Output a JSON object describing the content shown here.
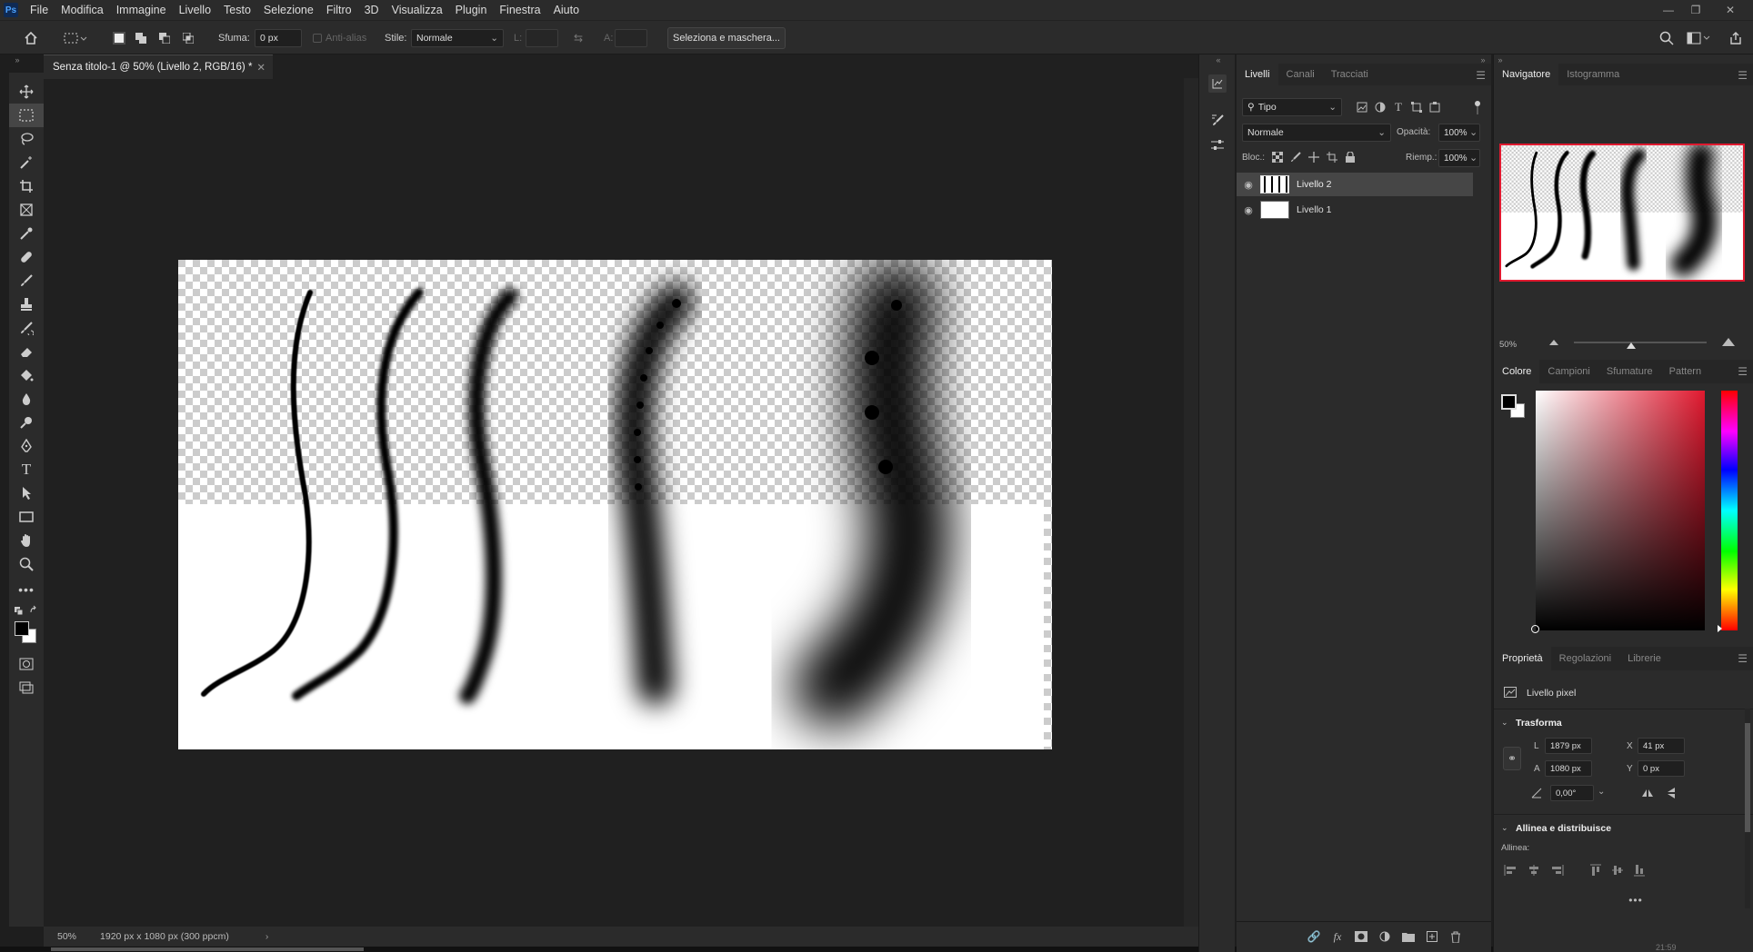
{
  "menubar": {
    "logo": "Ps",
    "items": [
      "File",
      "Modifica",
      "Immagine",
      "Livello",
      "Testo",
      "Selezione",
      "Filtro",
      "3D",
      "Visualizza",
      "Plugin",
      "Finestra",
      "Aiuto"
    ]
  },
  "options": {
    "feather_label": "Sfuma:",
    "feather_value": "0 px",
    "antialias_label": "Anti-alias",
    "style_label": "Stile:",
    "style_value": "Normale",
    "width_label": "L:",
    "height_label": "A:",
    "select_mask_label": "Seleziona e maschera..."
  },
  "document": {
    "tab_title": "Senza titolo-1 @ 50% (Livello 2, RGB/16) *",
    "zoom": "50%",
    "info": "1920 px x 1080 px (300 ppcm)"
  },
  "layers_panel": {
    "tabs": [
      "Livelli",
      "Canali",
      "Tracciati"
    ],
    "filter_label": "Tipo",
    "blend_mode": "Normale",
    "opacity_label": "Opacità:",
    "opacity_value": "100%",
    "lock_label": "Bloc.:",
    "fill_label": "Riemp.:",
    "fill_value": "100%",
    "layers": [
      {
        "name": "Livello 2",
        "selected": true
      },
      {
        "name": "Livello 1",
        "selected": false
      }
    ]
  },
  "navigator_panel": {
    "tabs": [
      "Navigatore",
      "Istogramma"
    ],
    "zoom": "50%"
  },
  "color_panel": {
    "tabs": [
      "Colore",
      "Campioni",
      "Sfumature",
      "Pattern"
    ]
  },
  "properties_panel": {
    "tabs": [
      "Proprietà",
      "Regolazioni",
      "Librerie"
    ],
    "layer_type": "Livello pixel",
    "transform_label": "Trasforma",
    "w_label": "L",
    "w_value": "1879 px",
    "h_label": "A",
    "h_value": "1080 px",
    "x_label": "X",
    "x_value": "41 px",
    "y_label": "Y",
    "y_value": "0 px",
    "angle_value": "0,00°",
    "align_label": "Allinea e distribuisce",
    "align_sub": "Allinea:"
  },
  "taskbar": {
    "time": "21:59"
  },
  "colors": {
    "accent_red": "#e0192f",
    "panel": "#2b2b2b",
    "foreground": "#000000",
    "background": "#ffffff"
  }
}
